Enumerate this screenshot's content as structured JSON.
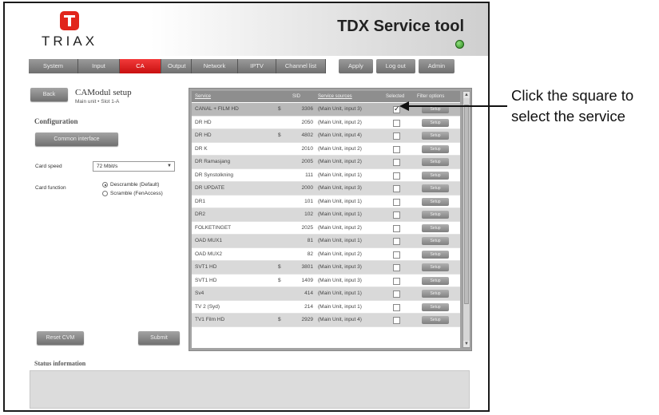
{
  "app": {
    "logo_text": "TRIAX",
    "title": "TDX Service tool"
  },
  "nav": {
    "tabs": [
      {
        "label": "System"
      },
      {
        "label": "Input"
      },
      {
        "label": "CA Modules",
        "active": true
      },
      {
        "label": "Output"
      },
      {
        "label": "Network"
      },
      {
        "label": "IPTV"
      },
      {
        "label": "Channel list"
      }
    ],
    "apply_label": "Apply",
    "logout_label": "Log out",
    "admin_label": "Admin"
  },
  "page": {
    "back_label": "Back",
    "title": "CAModul setup",
    "subtitle": "Main unit • Slot 1-A",
    "config_title": "Configuration",
    "common_interface_label": "Common interface",
    "card_speed_label": "Card speed",
    "card_speed_value": "72 Mbit/s",
    "card_function_label": "Card function",
    "radio_options": [
      {
        "label": "Descramble (Default)",
        "selected": true
      },
      {
        "label": "Scramble (FenAccess)",
        "selected": false
      }
    ],
    "reset_label": "Reset CVM",
    "submit_label": "Submit",
    "status_title": "Status information"
  },
  "table": {
    "headers": {
      "service": "Service",
      "sid": "SID",
      "source": "Service sources",
      "selected": "Selected",
      "filter": "Filter options"
    },
    "filter_button_label": "Setup",
    "rows": [
      {
        "name": "CANAL + FILM HD",
        "enc": "$",
        "sid": "3306",
        "source": "(Main Unit, input 3)",
        "checked": true
      },
      {
        "name": "DR HD",
        "enc": "",
        "sid": "2050",
        "source": "(Main Unit, input 2)",
        "checked": false
      },
      {
        "name": "DR HD",
        "enc": "$",
        "sid": "4802",
        "source": "(Main Unit, input 4)",
        "checked": false
      },
      {
        "name": "DR K",
        "enc": "",
        "sid": "2010",
        "source": "(Main Unit, input 2)",
        "checked": false
      },
      {
        "name": "DR Ramasjang",
        "enc": "",
        "sid": "2005",
        "source": "(Main Unit, input 2)",
        "checked": false
      },
      {
        "name": "DR Synstolkning",
        "enc": "",
        "sid": "111",
        "source": "(Main Unit, input 1)",
        "checked": false
      },
      {
        "name": "DR UPDATE",
        "enc": "",
        "sid": "2000",
        "source": "(Main Unit, input 3)",
        "checked": false
      },
      {
        "name": "DR1",
        "enc": "",
        "sid": "101",
        "source": "(Main Unit, input 1)",
        "checked": false
      },
      {
        "name": "DR2",
        "enc": "",
        "sid": "102",
        "source": "(Main Unit, input 1)",
        "checked": false
      },
      {
        "name": "FOLKETINGET",
        "enc": "",
        "sid": "2025",
        "source": "(Main Unit, input 2)",
        "checked": false
      },
      {
        "name": "OAD MUX1",
        "enc": "",
        "sid": "81",
        "source": "(Main Unit, input 1)",
        "checked": false
      },
      {
        "name": "OAD MUX2",
        "enc": "",
        "sid": "82",
        "source": "(Main Unit, input 2)",
        "checked": false
      },
      {
        "name": "SVT1 HD",
        "enc": "$",
        "sid": "3801",
        "source": "(Main Unit, input 3)",
        "checked": false
      },
      {
        "name": "SVT1 HD",
        "enc": "$",
        "sid": "1409",
        "source": "(Main Unit, input 3)",
        "checked": false
      },
      {
        "name": "Sv4",
        "enc": "",
        "sid": "414",
        "source": "(Main Unit, input 1)",
        "checked": false
      },
      {
        "name": "TV 2 (Syd)",
        "enc": "",
        "sid": "214",
        "source": "(Main Unit, input 1)",
        "checked": false
      },
      {
        "name": "TV1 Film HD",
        "enc": "$",
        "sid": "2929",
        "source": "(Main Unit, input 4)",
        "checked": false
      }
    ]
  },
  "annotation": {
    "line1": "Click the square to",
    "line2": "select the service"
  },
  "colors": {
    "accent": "#e1251b",
    "led": "#2f8a22"
  }
}
